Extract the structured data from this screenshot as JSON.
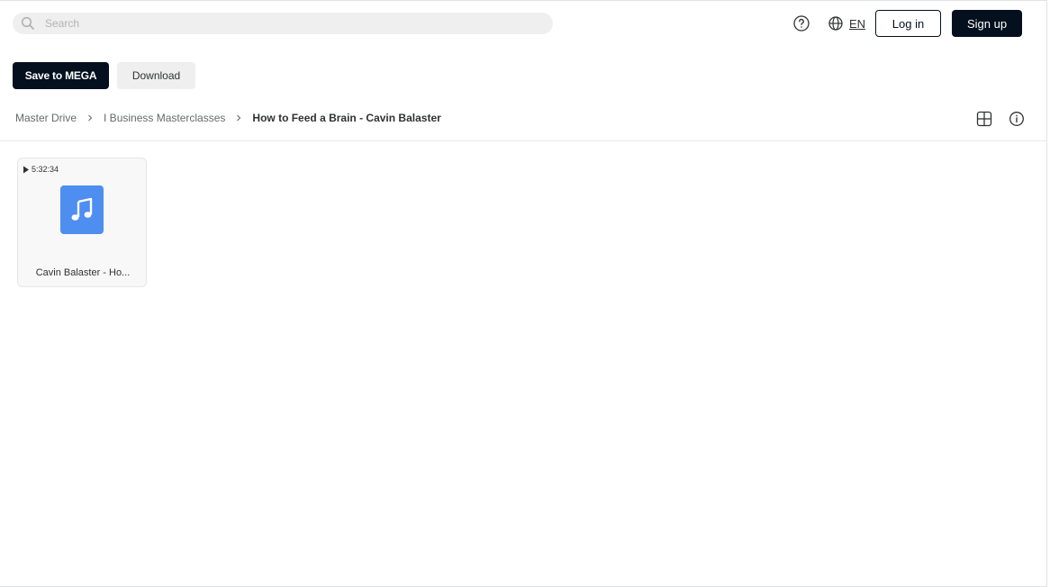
{
  "header": {
    "search": {
      "placeholder": "Search",
      "value": ""
    },
    "help_icon": "question-circle-icon",
    "language": {
      "icon": "globe-icon",
      "code": "EN"
    },
    "login_label": "Log in",
    "signup_label": "Sign up"
  },
  "actions": {
    "save_label": "Save to MEGA",
    "download_label": "Download"
  },
  "breadcrumb": {
    "items": [
      {
        "label": "Master Drive"
      },
      {
        "label": "I Business Masterclasses"
      },
      {
        "label": "How to Feed a Brain - Cavin Balaster"
      }
    ]
  },
  "toolbar": {
    "view_icon": "grid-view-icon",
    "info_icon": "info-icon"
  },
  "files": [
    {
      "name": "Cavin Balaster - Ho...",
      "duration": "5:32:34",
      "type_icon": "audio-file-icon",
      "thumb_color": "#4d8ef0"
    }
  ],
  "colors": {
    "primary": "#04101e",
    "secondary_bg": "#efefef",
    "audio_icon": "#4d8ef0"
  }
}
